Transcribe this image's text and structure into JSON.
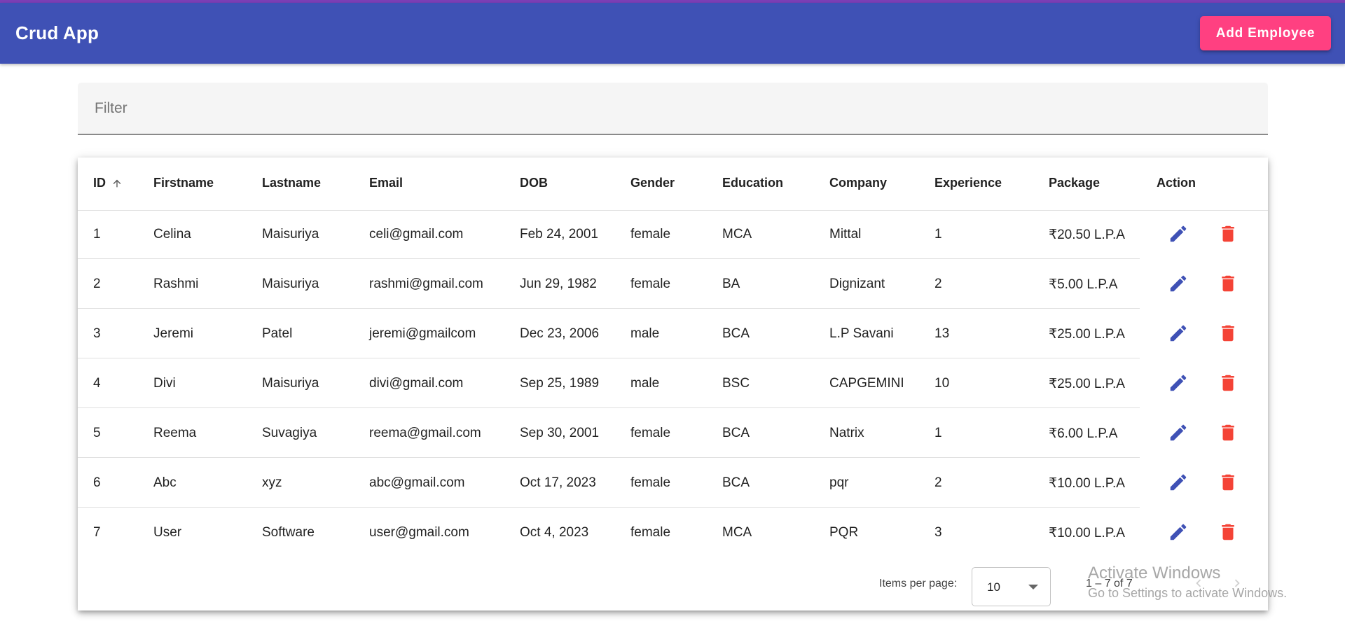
{
  "toolbar": {
    "title": "Crud App",
    "add_button_label": "Add Employee",
    "color": "#3f51b5",
    "accent": "#ff4081"
  },
  "filter": {
    "placeholder": "Filter",
    "value": ""
  },
  "table": {
    "columns": [
      "ID",
      "Firstname",
      "Lastname",
      "Email",
      "DOB",
      "Gender",
      "Education",
      "Company",
      "Experience",
      "Package",
      "Action"
    ],
    "sort": {
      "column": "ID",
      "icon": "arrow-up-icon"
    },
    "action_icons": {
      "edit": "pencil-icon",
      "delete": "trash-icon",
      "edit_color": "#3f51b5",
      "delete_color": "#f44336"
    },
    "rows": [
      [
        "1",
        "Celina",
        "Maisuriya",
        "celi@gmail.com",
        "Feb 24, 2001",
        "female",
        "MCA",
        "Mittal",
        "1",
        "₹20.50 L.P.A"
      ],
      [
        "2",
        "Rashmi",
        "Maisuriya",
        "rashmi@gmail.com",
        "Jun 29, 1982",
        "female",
        "BA",
        "Dignizant",
        "2",
        "₹5.00 L.P.A"
      ],
      [
        "3",
        "Jeremi",
        "Patel",
        "jeremi@gmailcom",
        "Dec 23, 2006",
        "male",
        "BCA",
        "L.P Savani",
        "13",
        "₹25.00 L.P.A"
      ],
      [
        "4",
        "Divi",
        "Maisuriya",
        "divi@gmail.com",
        "Sep 25, 1989",
        "male",
        "BSC",
        "CAPGEMINI",
        "10",
        "₹25.00 L.P.A"
      ],
      [
        "5",
        "Reema",
        "Suvagiya",
        "reema@gmail.com",
        "Sep 30, 2001",
        "female",
        "BCA",
        "Natrix",
        "1",
        "₹6.00 L.P.A"
      ],
      [
        "6",
        "Abc",
        "xyz",
        "abc@gmail.com",
        "Oct 17, 2023",
        "female",
        "BCA",
        "pqr",
        "2",
        "₹10.00 L.P.A"
      ],
      [
        "7",
        "User",
        "Software",
        "user@gmail.com",
        "Oct 4, 2023",
        "female",
        "MCA",
        "PQR",
        "3",
        "₹10.00 L.P.A"
      ]
    ]
  },
  "paginator": {
    "items_per_page_label": "Items per page:",
    "items_per_page_value": "10",
    "range_label": "1 – 7 of 7",
    "prev_icon": "chevron-left-icon",
    "next_icon": "chevron-right-icon"
  },
  "watermark": {
    "title": "Activate Windows",
    "subtitle": "Go to Settings to activate Windows."
  }
}
